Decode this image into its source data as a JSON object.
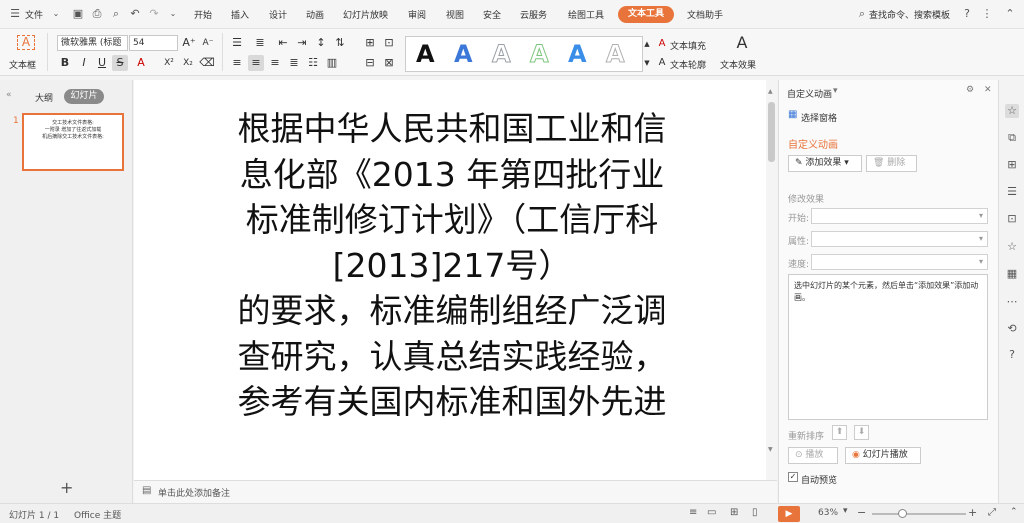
{
  "menubar": {
    "file": "文件",
    "tabs": [
      "开始",
      "插入",
      "设计",
      "动画",
      "幻灯片放映",
      "审阅",
      "视图",
      "安全",
      "云服务",
      "绘图工具",
      "文本工具",
      "文档助手"
    ],
    "search": "查找命令、搜索模板"
  },
  "ribbon": {
    "textbox": "文本框",
    "font_name": "微软雅黑 (标题",
    "font_size": "54",
    "text_fill": "文本填充",
    "text_outline": "文本轮廓",
    "text_effect": "文本效果",
    "wordart_colors": [
      "#111111",
      "#3b78d8",
      "#9aa0a6",
      "#7cc47c",
      "#3b8ee8",
      "#b0b0b0"
    ],
    "wordart_glyph": "A"
  },
  "left_panel": {
    "tab_outline": "大纲",
    "tab_slides": "幻灯片",
    "slide_number": "1",
    "thumb_lines": [
      "交工技术文件表格:",
      "一附录 增加了往返式加载",
      "机后摘除交工技术文件表格:"
    ],
    "add_slide": "+"
  },
  "slide": {
    "lines": [
      "根据中华人民共和国工业和信",
      "息化部《2013 年第四批行业",
      "标准制修订计划》（工信厅科",
      "[2013]217号）",
      "的要求，标准编制组经广泛调",
      "查研究，认真总结实践经验，",
      "参考有关国内标准和国外先进"
    ]
  },
  "notes": {
    "placeholder": "单击此处添加备注"
  },
  "right_panel": {
    "header": "自定义动画",
    "select_pane": "选择窗格",
    "section_title": "自定义动画",
    "add_effect": "添加效果",
    "delete": "删除",
    "modify_effect": "修改效果",
    "label_start": "开始:",
    "label_property": "属性:",
    "label_speed": "速度:",
    "hint": "选中幻灯片的某个元素，然后单击“添加效果”添加动画。",
    "reorder": "重新排序",
    "play": "播放",
    "slideshow": "幻灯片播放",
    "auto_preview": "自动预览",
    "accent": "#e8743b"
  },
  "statusbar": {
    "slide_info": "幻灯片 1 / 1",
    "theme": "Office 主题",
    "zoom": "63%"
  }
}
